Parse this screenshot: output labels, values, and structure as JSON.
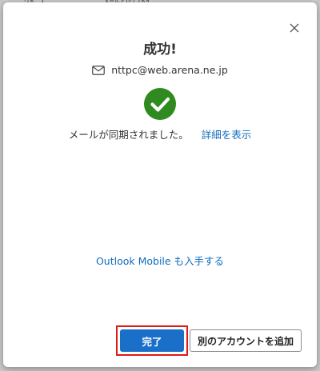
{
  "background": {
    "fragment_left": "ｳﾄﾞｽ",
    "fragment_right": "ﾒｰﾙｱｶｳﾝﾄｲ"
  },
  "dialog": {
    "title": "成功!",
    "email": "nttpc@web.arena.ne.jp",
    "message": "メールが同期されました。",
    "details_link": "詳細を表示",
    "outlook_link": "Outlook Mobile も入手する",
    "done_button": "完了",
    "add_account_button": "別のアカウントを追加"
  },
  "icons": {
    "close": "close-icon",
    "mail": "mail-icon",
    "success": "check-circle-icon"
  },
  "colors": {
    "accent": "#1a6fc9",
    "link": "#0f6cbd",
    "success": "#2f8a1f",
    "highlight": "#e01919"
  }
}
